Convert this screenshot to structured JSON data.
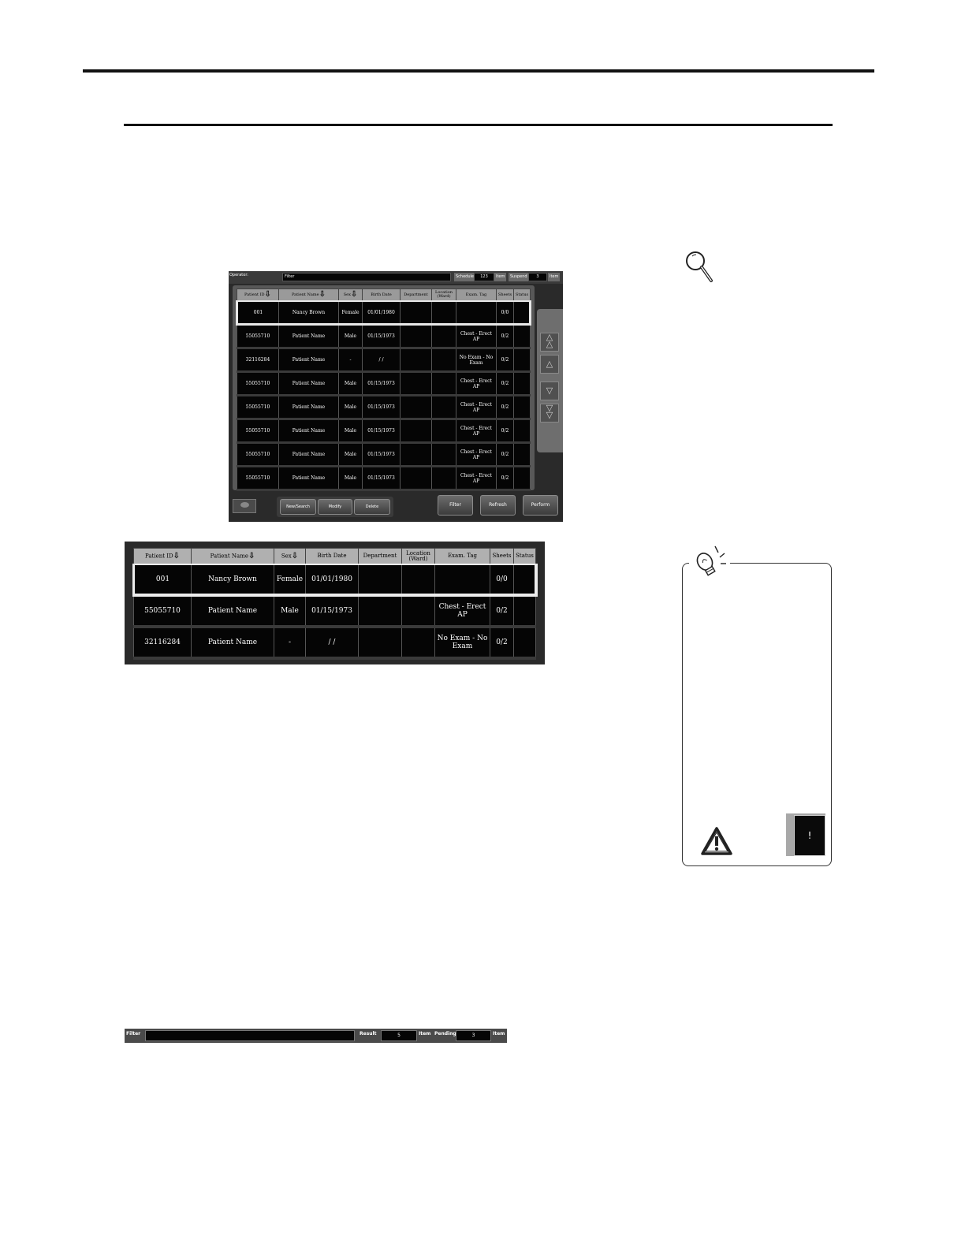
{
  "main_screen": {
    "operator_label": "Operator:",
    "filter_label": "Filter",
    "schedule_label": "Schedule",
    "schedule_count": "123",
    "schedule_unit": "Item",
    "suspend_label": "Suspend",
    "suspend_count": "3",
    "suspend_unit": "Item",
    "columns": [
      "Patient ID",
      "Patient Name",
      "Sex",
      "Birth Date",
      "Department",
      "Location (Ward)",
      "Exam. Tag",
      "Sheets",
      "Status"
    ],
    "rows": [
      {
        "id": "001",
        "name": "Nancy Brown",
        "sex": "Female",
        "birth": "01/01/1980",
        "dept": "",
        "loc": "",
        "tag": "",
        "sheets": "0/0",
        "status": ""
      },
      {
        "id": "55055710",
        "name": "Patient Name",
        "sex": "Male",
        "birth": "01/15/1973",
        "dept": "",
        "loc": "",
        "tag": "Chest - Erect AP",
        "sheets": "0/2",
        "status": ""
      },
      {
        "id": "32116284",
        "name": "Patient Name",
        "sex": "-",
        "birth": "/  /",
        "dept": "",
        "loc": "",
        "tag": "No Exam - No Exam",
        "sheets": "0/2",
        "status": ""
      },
      {
        "id": "55055710",
        "name": "Patient Name",
        "sex": "Male",
        "birth": "01/15/1973",
        "dept": "",
        "loc": "",
        "tag": "Chest - Erect AP",
        "sheets": "0/2",
        "status": ""
      },
      {
        "id": "55055710",
        "name": "Patient Name",
        "sex": "Male",
        "birth": "01/15/1973",
        "dept": "",
        "loc": "",
        "tag": "Chest - Erect AP",
        "sheets": "0/2",
        "status": ""
      },
      {
        "id": "55055710",
        "name": "Patient Name",
        "sex": "Male",
        "birth": "01/15/1973",
        "dept": "",
        "loc": "",
        "tag": "Chest - Erect AP",
        "sheets": "0/2",
        "status": ""
      },
      {
        "id": "55055710",
        "name": "Patient Name",
        "sex": "Male",
        "birth": "01/15/1973",
        "dept": "",
        "loc": "",
        "tag": "Chest - Erect AP",
        "sheets": "0/2",
        "status": ""
      },
      {
        "id": "55055710",
        "name": "Patient Name",
        "sex": "Male",
        "birth": "01/15/1973",
        "dept": "",
        "loc": "",
        "tag": "Chest - Erect AP",
        "sheets": "0/2",
        "status": ""
      }
    ],
    "buttons": {
      "new_search": "New/Search",
      "modify": "Modify",
      "delete": "Delete",
      "filter": "Filter",
      "refresh": "Refresh",
      "perform": "Perform"
    },
    "scroll_icons": [
      "double-up-arrow-icon",
      "up-arrow-icon",
      "down-arrow-icon",
      "double-down-arrow-icon"
    ]
  },
  "zoom_table": {
    "columns": [
      "Patient ID",
      "Patient Name",
      "Sex",
      "Birth Date",
      "Department",
      "Location (Ward)",
      "Exam. Tag",
      "Sheets",
      "Status"
    ],
    "rows": [
      {
        "id": "001",
        "name": "Nancy Brown",
        "sex": "Female",
        "birth": "01/01/1980",
        "dept": "",
        "loc": "",
        "tag": "",
        "sheets": "0/0",
        "status": ""
      },
      {
        "id": "55055710",
        "name": "Patient Name",
        "sex": "Male",
        "birth": "01/15/1973",
        "dept": "",
        "loc": "",
        "tag": "Chest - Erect AP",
        "sheets": "0/2",
        "status": ""
      },
      {
        "id": "32116284",
        "name": "Patient Name",
        "sex": "-",
        "birth": "/  /",
        "dept": "",
        "loc": "",
        "tag": "No Exam - No Exam",
        "sheets": "0/2",
        "status": ""
      }
    ]
  },
  "filter_bar": {
    "filter_label": "Filter",
    "filter_value": "",
    "result_label": "Result",
    "result_count": "5",
    "result_unit": "Item",
    "pending_label": "Pending",
    "pending_count": "3",
    "pending_unit": "Item"
  },
  "hint_box": {
    "icons": [
      "magnifier-icon",
      "lightbulb-icon",
      "warning-icon"
    ],
    "dark_box_text": "!"
  }
}
